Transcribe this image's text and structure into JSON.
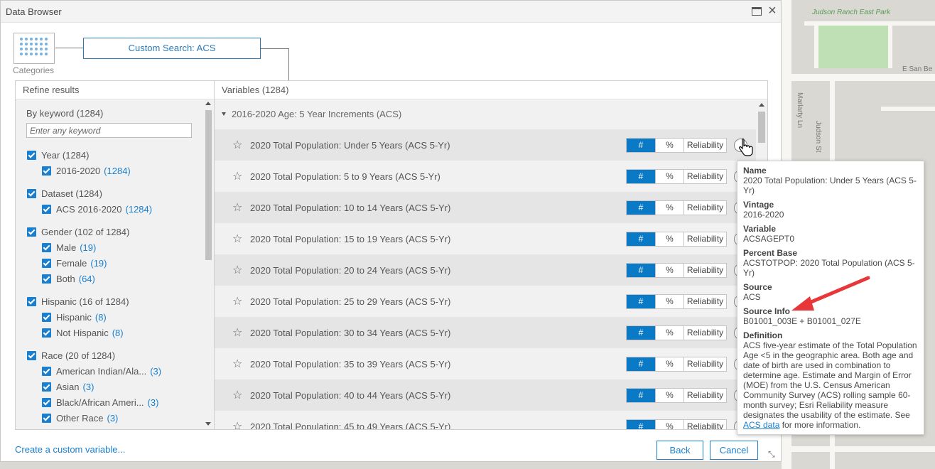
{
  "window": {
    "title": "Data Browser"
  },
  "breadcrumb": {
    "categories_label": "Categories",
    "current": "Custom Search: ACS"
  },
  "refine": {
    "header": "Refine results",
    "keyword_label": "By keyword (1284)",
    "keyword_placeholder": "Enter any keyword",
    "facets": [
      {
        "label": "Year (1284)",
        "count": ""
      },
      {
        "label": "2016-2020",
        "count": "(1284)"
      },
      {
        "label": "Dataset (1284)",
        "count": ""
      },
      {
        "label": "ACS 2016-2020",
        "count": "(1284)"
      },
      {
        "label": "Gender (102 of 1284)",
        "count": ""
      },
      {
        "label": "Male",
        "count": "(19)"
      },
      {
        "label": "Female",
        "count": "(19)"
      },
      {
        "label": "Both",
        "count": "(64)"
      },
      {
        "label": "Hispanic (16 of 1284)",
        "count": ""
      },
      {
        "label": "Hispanic",
        "count": "(8)"
      },
      {
        "label": "Not Hispanic",
        "count": "(8)"
      },
      {
        "label": "Race (20 of 1284)",
        "count": ""
      },
      {
        "label": "American Indian/Ala...",
        "count": "(3)"
      },
      {
        "label": "Asian",
        "count": "(3)"
      },
      {
        "label": "Black/African Ameri...",
        "count": "(3)"
      },
      {
        "label": "Other Race",
        "count": "(3)"
      }
    ]
  },
  "variables": {
    "header": "Variables (1284)",
    "group": "2016-2020 Age: 5 Year Increments (ACS)",
    "toggle": {
      "hash": "#",
      "pct": "%",
      "rel": "Reliability"
    },
    "star": "☆",
    "rows": [
      "2020 Total Population: Under 5 Years (ACS 5-Yr)",
      "2020 Total Population: 5 to 9 Years (ACS 5-Yr)",
      "2020 Total Population: 10 to 14 Years (ACS 5-Yr)",
      "2020 Total Population: 15 to 19 Years (ACS 5-Yr)",
      "2020 Total Population: 20 to 24 Years (ACS 5-Yr)",
      "2020 Total Population: 25 to 29 Years (ACS 5-Yr)",
      "2020 Total Population: 30 to 34 Years (ACS 5-Yr)",
      "2020 Total Population: 35 to 39 Years (ACS 5-Yr)",
      "2020 Total Population: 40 to 44 Years (ACS 5-Yr)",
      "2020 Total Population: 45 to 49 Years (ACS 5-Yr)"
    ]
  },
  "footer": {
    "custom_link": "Create a custom variable...",
    "back": "Back",
    "cancel": "Cancel"
  },
  "popup": {
    "name_k": "Name",
    "name_v": "2020 Total Population: Under 5 Years (ACS 5-Yr)",
    "vintage_k": "Vintage",
    "vintage_v": "2016-2020",
    "variable_k": "Variable",
    "variable_v": "ACSAGEPT0",
    "base_k": "Percent Base",
    "base_v": "ACSTOTPOP: 2020 Total Population (ACS 5-Yr)",
    "source_k": "Source",
    "source_v": "ACS",
    "srcinfo_k": "Source Info",
    "srcinfo_v": "B01001_003E + B01001_027E",
    "def_k": "Definition",
    "def_v": "ACS five-year estimate of the Total Population Age <5 in the geographic area. Both age and date of birth are used in combination to determine age. Estimate and Margin of Error (MOE) from the U.S. Census American Community Survey (ACS) rolling sample 60-month survey; Esri Reliability measure designates the usability of the estimate. See",
    "def_link": "ACS data",
    "def_tail": " for more information."
  },
  "map": {
    "park_name": "Judson Ranch East Park",
    "street1": "E San Be",
    "street2": "Marlarty Ln",
    "street3": "Judson St"
  },
  "colors": {
    "accent": "#1a7fce",
    "annotation_arrow": "#e8373a"
  }
}
